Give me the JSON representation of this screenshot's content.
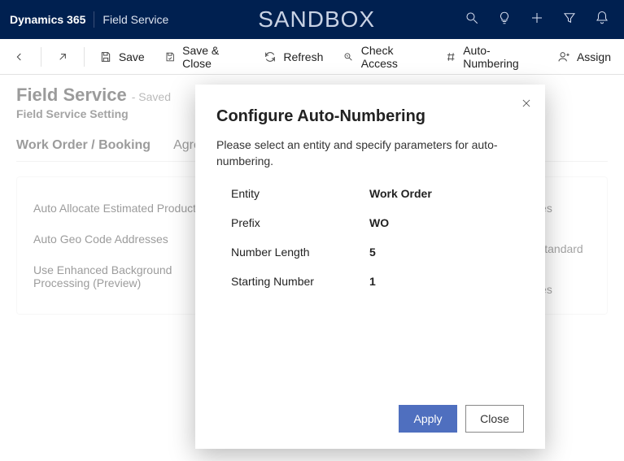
{
  "topbar": {
    "product": "Dynamics 365",
    "module": "Field Service",
    "environment": "SANDBOX"
  },
  "cmdbar": {
    "save": "Save",
    "save_close": "Save & Close",
    "refresh": "Refresh",
    "check_access": "Check Access",
    "auto_numbering": "Auto-Numbering",
    "assign": "Assign"
  },
  "page": {
    "title": "Field Service",
    "title_suffix": "- Saved",
    "subtitle": "Field Service Setting",
    "tabs": [
      "Work Order / Booking",
      "Agreement"
    ],
    "fields": {
      "auto_allocate": "Auto Allocate Estimated Products",
      "auto_geo": "Auto Geo Code Addresses",
      "use_enhanced": "Use Enhanced Background Processing (Preview)"
    },
    "right_values": [
      "Yes",
      "/Standard",
      "Yes"
    ]
  },
  "modal": {
    "title": "Configure Auto-Numbering",
    "instruction": "Please select an entity and specify parameters for auto-numbering.",
    "fields": {
      "entity_label": "Entity",
      "entity_value": "Work Order",
      "prefix_label": "Prefix",
      "prefix_value": "WO",
      "length_label": "Number Length",
      "length_value": "5",
      "start_label": "Starting Number",
      "start_value": "1"
    },
    "buttons": {
      "apply": "Apply",
      "close": "Close"
    }
  }
}
